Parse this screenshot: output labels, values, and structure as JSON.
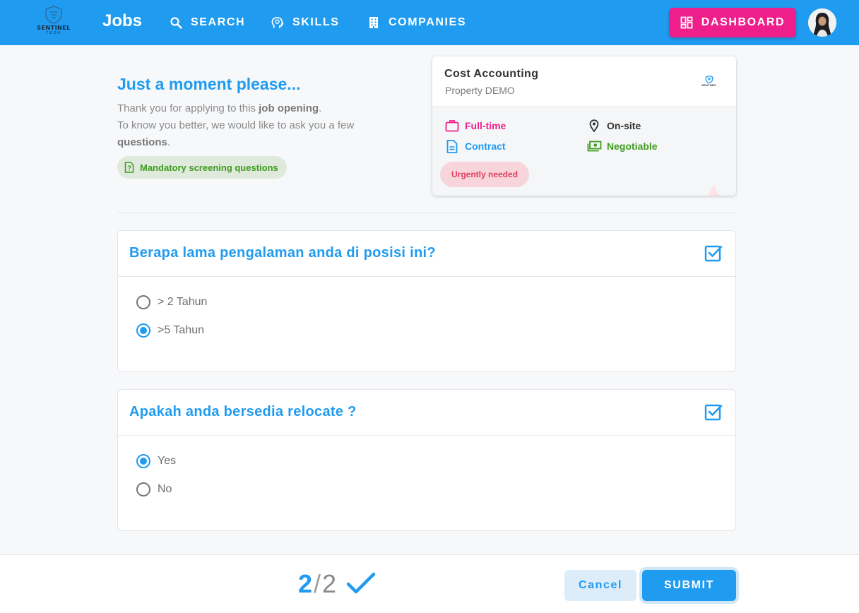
{
  "header": {
    "logo_text": "SENTINEL",
    "logo_subtext": "TECH",
    "brand": "Jobs",
    "nav": [
      {
        "label": "SEARCH",
        "icon": "search-icon"
      },
      {
        "label": "SKILLS",
        "icon": "head-lightbulb-icon"
      },
      {
        "label": "COMPANIES",
        "icon": "building-icon"
      }
    ],
    "dashboard_label": "DASHBOARD",
    "dashboard_icon": "dashboard-icon",
    "colors": {
      "bar": "#1f9bf0",
      "dashboard": "#ee1f8a"
    }
  },
  "intro": {
    "title": "Just a moment please...",
    "line1_pre": "Thank you for applying to this ",
    "line1_bold": "job opening",
    "line1_post": ".",
    "line2_pre": "To know you better, we would like to ask you a few ",
    "line2_bold": "questions",
    "line2_post": ".",
    "chip": "Mandatory screening questions"
  },
  "job": {
    "title": "Cost Accounting",
    "company": "Property DEMO",
    "employment": "Full-time",
    "contract": "Contract",
    "location": "On-site",
    "salary": "Negotiable",
    "urgent": "Urgently needed"
  },
  "questions": [
    {
      "title": "Berapa lama pengalaman anda di posisi ini?",
      "options": [
        {
          "label": "> 2 Tahun",
          "selected": false
        },
        {
          "label": ">5 Tahun",
          "selected": true
        }
      ]
    },
    {
      "title": "Apakah anda bersedia relocate ?",
      "options": [
        {
          "label": "Yes",
          "selected": true
        },
        {
          "label": "No",
          "selected": false
        }
      ]
    }
  ],
  "footer": {
    "step_current": "2",
    "step_sep": "/",
    "step_total": "2",
    "cancel_label": "Cancel",
    "submit_label": "SUBMIT"
  }
}
